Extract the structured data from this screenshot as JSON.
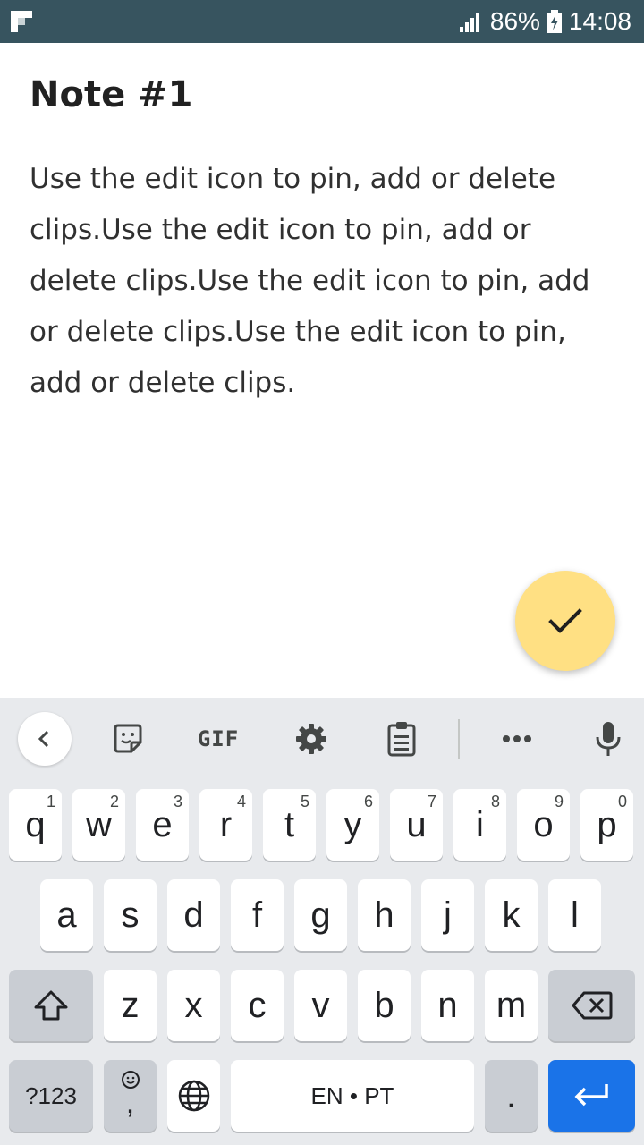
{
  "status_bar": {
    "battery_percent": "86%",
    "time": "14:08",
    "icons": [
      "flipboard-icon",
      "signal-icon",
      "battery-charging-icon"
    ]
  },
  "note": {
    "title": "Note #1",
    "body": "Use the edit icon to pin, add or delete clips.Use the edit icon to pin, add or delete clips.Use the edit icon to pin, add or delete clips.Use the edit icon to pin, add or delete clips."
  },
  "fab": {
    "icon": "check-icon",
    "color": "#ffe083"
  },
  "keyboard": {
    "toolbar": {
      "gif_label": "GIF",
      "icons": [
        "back-chevron-icon",
        "sticker-icon",
        "gear-icon",
        "clipboard-icon",
        "more-dots-icon",
        "microphone-icon"
      ]
    },
    "row1": [
      {
        "char": "q",
        "hint": "1"
      },
      {
        "char": "w",
        "hint": "2"
      },
      {
        "char": "e",
        "hint": "3"
      },
      {
        "char": "r",
        "hint": "4"
      },
      {
        "char": "t",
        "hint": "5"
      },
      {
        "char": "y",
        "hint": "6"
      },
      {
        "char": "u",
        "hint": "7"
      },
      {
        "char": "i",
        "hint": "8"
      },
      {
        "char": "o",
        "hint": "9"
      },
      {
        "char": "p",
        "hint": "0"
      }
    ],
    "row2": [
      "a",
      "s",
      "d",
      "f",
      "g",
      "h",
      "j",
      "k",
      "l"
    ],
    "row3": [
      "z",
      "x",
      "c",
      "v",
      "b",
      "n",
      "m"
    ],
    "bottom": {
      "symbols_label": "?123",
      "comma_label": ",",
      "space_label": "EN • PT",
      "period_label": ".",
      "enter_color": "#1a73e8"
    }
  }
}
